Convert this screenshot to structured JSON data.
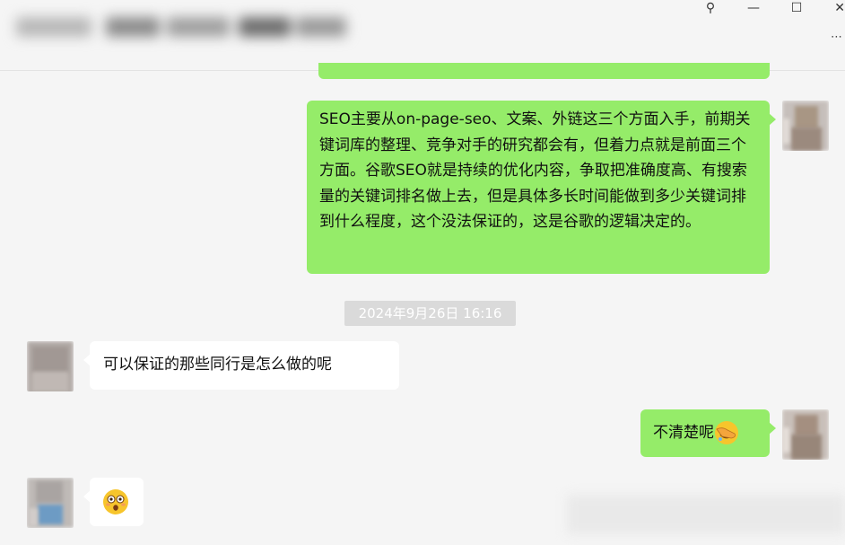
{
  "window": {
    "controls": {
      "pin_glyph": "⚲",
      "minimize_glyph": "—",
      "maximize_glyph": "☐",
      "close_glyph": "✕",
      "more_glyph": "⋯"
    }
  },
  "chat": {
    "messages": [
      {
        "side": "right",
        "text": "SEO主要从on-page-seo、文案、外链这三个方面入手，前期关键词库的整理、竞争对手的研究都会有，但着力点就是前面三个方面。谷歌SEO就是持续的优化内容，争取把准确度高、有搜索量的关键词排名做上去，但是具体多长时间能做到多少关键词排到什么程度，这个没法保证的，这是谷歌的逻辑决定的。"
      },
      {
        "type": "timestamp",
        "text": "2024年9月26日 16:16"
      },
      {
        "side": "left",
        "text": "可以保证的那些同行是怎么做的呢"
      },
      {
        "side": "right",
        "text": "不清楚呢",
        "emoji": "facepalm-emoji"
      },
      {
        "side": "left",
        "text": "",
        "emoji": "astonished-emoji"
      }
    ]
  },
  "icons": {
    "pin": "pin-icon",
    "minimize": "minimize-icon",
    "maximize": "maximize-icon",
    "close": "close-icon",
    "more": "more-options-icon"
  },
  "colors": {
    "background": "#f5f5f5",
    "own_bubble": "#95ec69",
    "other_bubble": "#ffffff",
    "timestamp_bg": "#dadada",
    "timestamp_text": "#ffffff"
  }
}
